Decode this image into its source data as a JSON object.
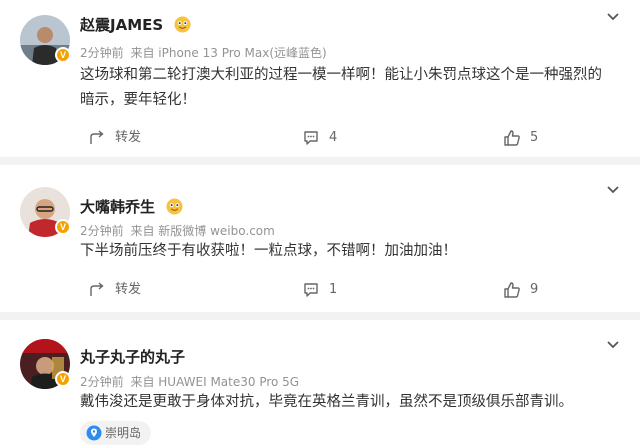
{
  "comments": [
    {
      "username": "赵震JAMES",
      "time": "2分钟前",
      "source": "来自 iPhone 13 Pro Max(远峰蓝色)",
      "text": "这场球和第二轮打澳大利亚的过程一模一样啊！能让小朱罚点球这个是一种强烈的暗示，要年轻化！",
      "share_label": "转发",
      "comment_count": "4",
      "like_count": "5",
      "name_icon": "ok-hand-emoji-icon",
      "badge_icon": "verified-v-badge-icon"
    },
    {
      "username": "大嘴韩乔生",
      "time": "2分钟前",
      "source": "来自 新版微博 weibo.com",
      "text": "下半场前压终于有收获啦！一粒点球，不错啊！加油加油！",
      "share_label": "转发",
      "comment_count": "1",
      "like_count": "9",
      "name_icon": "ok-hand-emoji-icon",
      "badge_icon": "verified-v-badge-icon"
    },
    {
      "username": "丸子丸子的丸子",
      "time": "2分钟前",
      "source": "来自 HUAWEI Mate30 Pro 5G",
      "text": "戴伟浚还是更敢于身体对抗，毕竟在英格兰青训，虽然不是顶级俱乐部青训。",
      "location": "崇明岛",
      "badge_icon": "verified-v-badge-icon"
    }
  ],
  "colors": {
    "badge": "#f5a200",
    "muted": "#939393",
    "location_pin": "#2d8cf0"
  }
}
